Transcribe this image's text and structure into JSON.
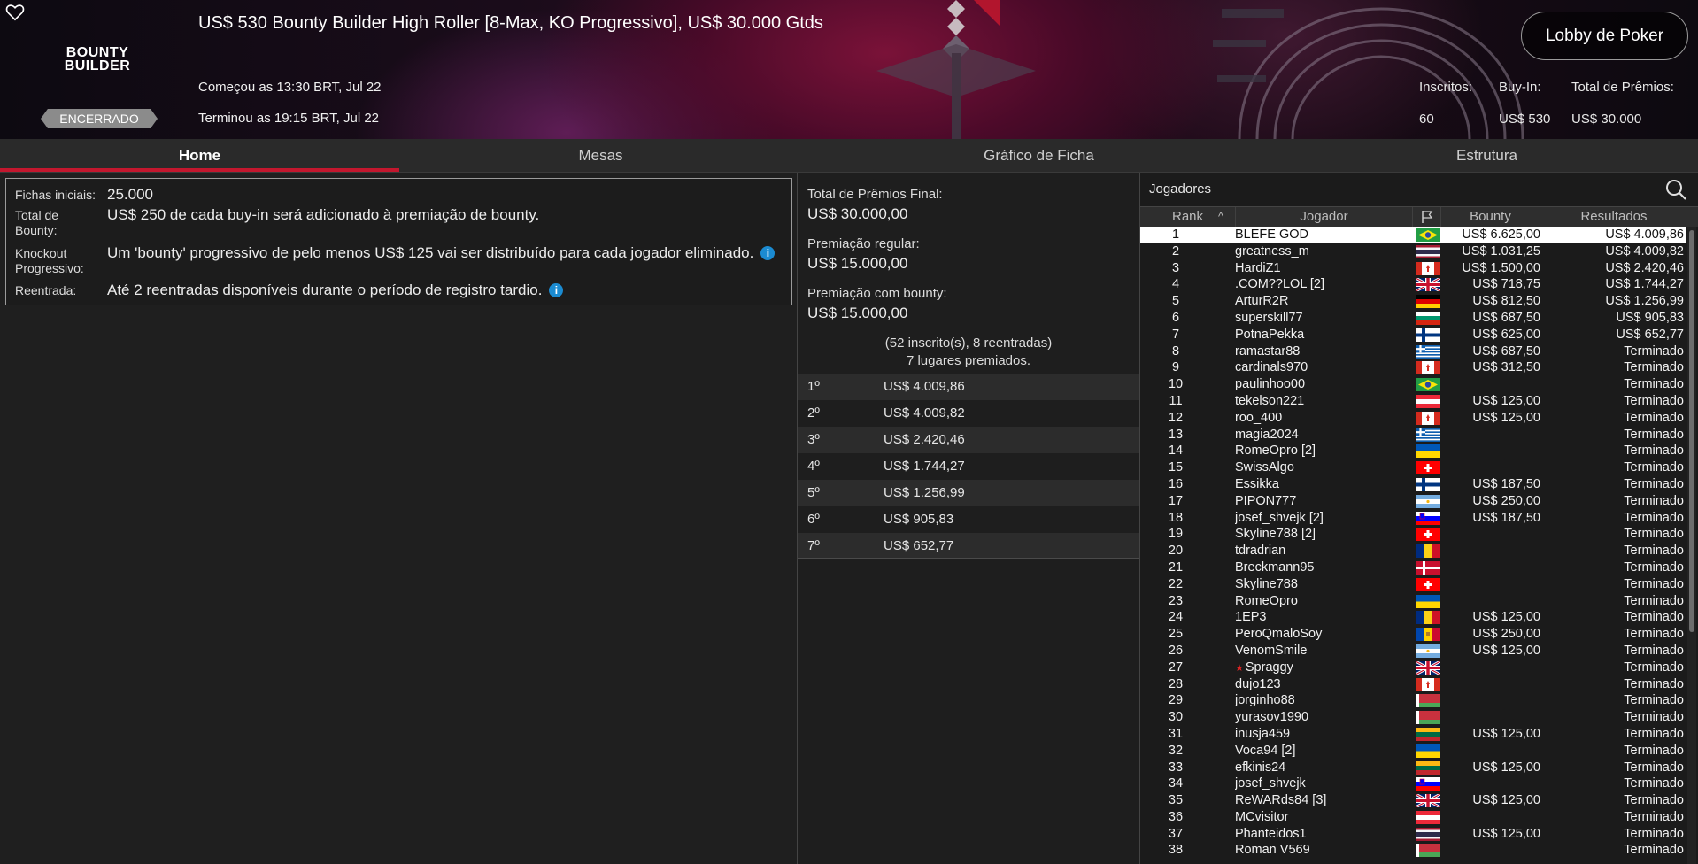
{
  "header": {
    "logo_line1": "BOUNTY",
    "logo_line2": "BUILDER",
    "status": "ENCERRADO",
    "title": "US$ 530 Bounty Builder High Roller [8-Max, KO Progressivo], US$ 30.000 Gtds",
    "started": "Começou as 13:30 BRT, Jul 22",
    "ended": "Terminou as 19:15 BRT, Jul 22",
    "lobby_button": "Lobby de Poker",
    "stats": {
      "entrants_label": "Inscritos:",
      "entrants": "60",
      "buyin_label": "Buy-In:",
      "buyin": "US$ 530",
      "prize_label": "Total de Prêmios:",
      "prize": "US$ 30.000"
    }
  },
  "tabs": [
    {
      "label": "Home",
      "active": true
    },
    {
      "label": "Mesas"
    },
    {
      "label": "Gráfico de Ficha"
    },
    {
      "label": "Estrutura"
    }
  ],
  "info": [
    {
      "label": "Fichas iniciais:",
      "value": "25.000"
    },
    {
      "label": "Total de Bounty:",
      "value": "US$ 250 de cada buy-in será adicionado à premiação de bounty."
    },
    {
      "label": "Knockout Progressivo:",
      "value": "Um 'bounty' progressivo de pelo menos US$ 125 vai ser distribuído para cada jogador eliminado."
    },
    {
      "label": "Reentrada:",
      "value": "Até 2 reentradas disponíveis durante o período de registro tardio."
    }
  ],
  "prizes": {
    "total_label": "Total de Prêmios Final:",
    "total": "US$ 30.000,00",
    "regular_label": "Premiação regular:",
    "regular": "US$ 15.000,00",
    "bounty_label": "Premiação com bounty:",
    "bounty": "US$ 15.000,00",
    "entries_note": "(52 inscrito(s), 8 reentradas)",
    "paid_note": "7 lugares premiados.",
    "places": [
      {
        "pos": "1º",
        "amount": "US$ 4.009,86"
      },
      {
        "pos": "2º",
        "amount": "US$ 4.009,82"
      },
      {
        "pos": "3º",
        "amount": "US$ 2.420,46"
      },
      {
        "pos": "4º",
        "amount": "US$ 1.744,27"
      },
      {
        "pos": "5º",
        "amount": "US$ 1.256,99"
      },
      {
        "pos": "6º",
        "amount": "US$ 905,83"
      },
      {
        "pos": "7º",
        "amount": "US$ 652,77"
      }
    ]
  },
  "players": {
    "title": "Jogadores",
    "columns": {
      "rank": "Rank",
      "player": "Jogador",
      "bounty": "Bounty",
      "results": "Resultados"
    },
    "rows": [
      {
        "rank": "1",
        "name": "BLEFE GOD",
        "flag": "br",
        "bounty": "US$ 6.625,00",
        "result": "US$ 4.009,86"
      },
      {
        "rank": "2",
        "name": "greatness_m",
        "flag": "th",
        "bounty": "US$ 1.031,25",
        "result": "US$ 4.009,82"
      },
      {
        "rank": "3",
        "name": "HardiZ1",
        "flag": "ca",
        "bounty": "US$ 1.500,00",
        "result": "US$ 2.420,46"
      },
      {
        "rank": "4",
        "name": ".COM??LOL [2]",
        "flag": "gb",
        "bounty": "US$ 718,75",
        "result": "US$ 1.744,27"
      },
      {
        "rank": "5",
        "name": "ArturR2R",
        "flag": "de",
        "bounty": "US$ 812,50",
        "result": "US$ 1.256,99"
      },
      {
        "rank": "6",
        "name": "superskill77",
        "flag": "bg",
        "bounty": "US$ 687,50",
        "result": "US$ 905,83"
      },
      {
        "rank": "7",
        "name": "PotnaPekka",
        "flag": "fi",
        "bounty": "US$ 625,00",
        "result": "US$ 652,77"
      },
      {
        "rank": "8",
        "name": "ramastar88",
        "flag": "gr",
        "bounty": "US$ 687,50",
        "result": "Terminado"
      },
      {
        "rank": "9",
        "name": "cardinals970",
        "flag": "ca",
        "bounty": "US$ 312,50",
        "result": "Terminado"
      },
      {
        "rank": "10",
        "name": "paulinhoo00",
        "flag": "br",
        "bounty": "",
        "result": "Terminado"
      },
      {
        "rank": "11",
        "name": "tekelson221",
        "flag": "at",
        "bounty": "US$ 125,00",
        "result": "Terminado"
      },
      {
        "rank": "12",
        "name": "roo_400",
        "flag": "ca",
        "bounty": "US$ 125,00",
        "result": "Terminado"
      },
      {
        "rank": "13",
        "name": "magia2024",
        "flag": "gr",
        "bounty": "",
        "result": "Terminado"
      },
      {
        "rank": "14",
        "name": "RomeOpro [2]",
        "flag": "ua",
        "bounty": "",
        "result": "Terminado"
      },
      {
        "rank": "15",
        "name": "SwissAlgo",
        "flag": "ch",
        "bounty": "",
        "result": "Terminado"
      },
      {
        "rank": "16",
        "name": "Essikka",
        "flag": "fi",
        "bounty": "US$ 187,50",
        "result": "Terminado"
      },
      {
        "rank": "17",
        "name": "PIPON777",
        "flag": "ar",
        "bounty": "US$ 250,00",
        "result": "Terminado"
      },
      {
        "rank": "18",
        "name": "josef_shvejk [2]",
        "flag": "si",
        "bounty": "US$ 187,50",
        "result": "Terminado"
      },
      {
        "rank": "19",
        "name": "Skyline788 [2]",
        "flag": "ch",
        "bounty": "",
        "result": "Terminado"
      },
      {
        "rank": "20",
        "name": "tdradrian",
        "flag": "ro",
        "bounty": "",
        "result": "Terminado"
      },
      {
        "rank": "21",
        "name": "Breckmann95",
        "flag": "dk",
        "bounty": "",
        "result": "Terminado"
      },
      {
        "rank": "22",
        "name": "Skyline788",
        "flag": "ch",
        "bounty": "",
        "result": "Terminado"
      },
      {
        "rank": "23",
        "name": "RomeOpro",
        "flag": "ua",
        "bounty": "",
        "result": "Terminado"
      },
      {
        "rank": "24",
        "name": "1EP3",
        "flag": "ro",
        "bounty": "US$ 125,00",
        "result": "Terminado"
      },
      {
        "rank": "25",
        "name": "PeroQmaloSoy",
        "flag": "md",
        "bounty": "US$ 250,00",
        "result": "Terminado"
      },
      {
        "rank": "26",
        "name": "VenomSmile",
        "flag": "ar",
        "bounty": "US$ 125,00",
        "result": "Terminado"
      },
      {
        "rank": "27",
        "name": "Spraggy",
        "star": true,
        "flag": "gb",
        "bounty": "",
        "result": "Terminado"
      },
      {
        "rank": "28",
        "name": "dujo123",
        "flag": "ca",
        "bounty": "",
        "result": "Terminado"
      },
      {
        "rank": "29",
        "name": "jorginho88",
        "flag": "by",
        "bounty": "",
        "result": "Terminado"
      },
      {
        "rank": "30",
        "name": "yurasov1990",
        "flag": "by",
        "bounty": "",
        "result": "Terminado"
      },
      {
        "rank": "31",
        "name": "inusja459",
        "flag": "lt",
        "bounty": "US$ 125,00",
        "result": "Terminado"
      },
      {
        "rank": "32",
        "name": "Voca94 [2]",
        "flag": "ua",
        "bounty": "",
        "result": "Terminado"
      },
      {
        "rank": "33",
        "name": "efkinis24",
        "flag": "lt",
        "bounty": "US$ 125,00",
        "result": "Terminado"
      },
      {
        "rank": "34",
        "name": "josef_shvejk",
        "flag": "si",
        "bounty": "",
        "result": "Terminado"
      },
      {
        "rank": "35",
        "name": "ReWARds84 [3]",
        "flag": "gb",
        "bounty": "US$ 125,00",
        "result": "Terminado"
      },
      {
        "rank": "36",
        "name": "MCvisitor",
        "flag": "at",
        "bounty": "",
        "result": "Terminado"
      },
      {
        "rank": "37",
        "name": "Phanteidos1",
        "flag": "th",
        "bounty": "US$ 125,00",
        "result": "Terminado"
      },
      {
        "rank": "38",
        "name": "Roman V569",
        "flag": "by",
        "bounty": "",
        "result": "Terminado"
      }
    ]
  },
  "colors": {
    "accent": "#c3172e",
    "info": "#1b8bd1",
    "status_badge": "#8b8b8b"
  }
}
